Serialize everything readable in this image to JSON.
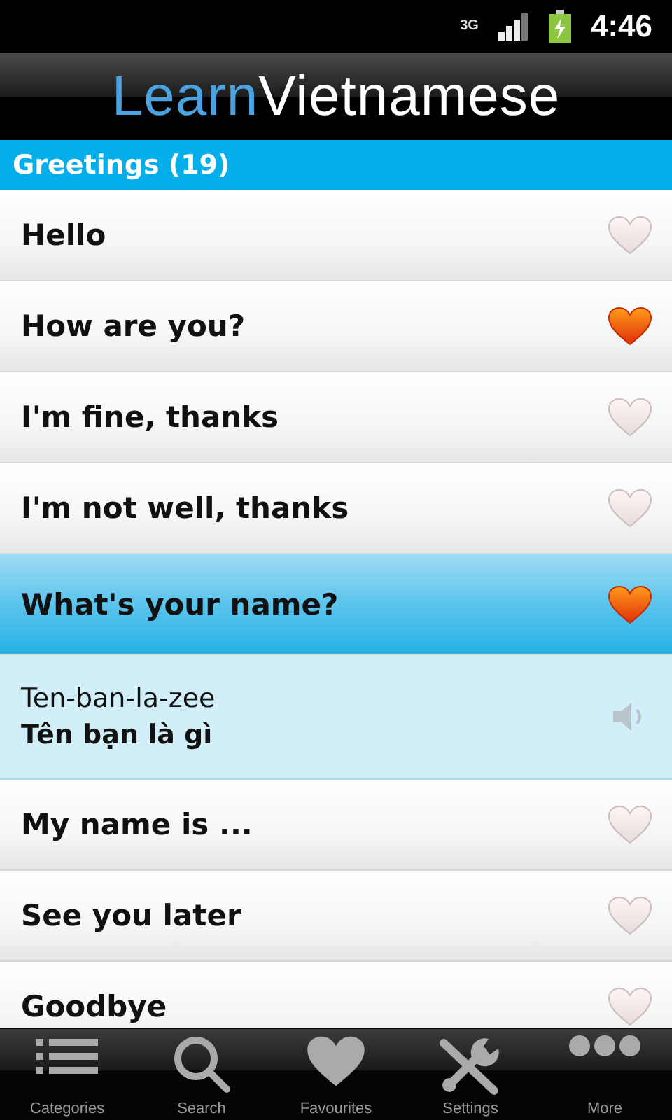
{
  "status_bar": {
    "network": "3G",
    "time": "4:46"
  },
  "logo": {
    "first": "Learn",
    "second": "Vietnamese"
  },
  "section": {
    "title": "Greetings (19)"
  },
  "rows": [
    {
      "kind": "phrase",
      "text": "Hello",
      "favourite": false,
      "selected": false
    },
    {
      "kind": "phrase",
      "text": "How are you?",
      "favourite": true,
      "selected": false
    },
    {
      "kind": "phrase",
      "text": "I'm fine, thanks",
      "favourite": false,
      "selected": false
    },
    {
      "kind": "phrase",
      "text": "I'm not well, thanks",
      "favourite": false,
      "selected": false
    },
    {
      "kind": "phrase",
      "text": "What's your name?",
      "favourite": true,
      "selected": true
    },
    {
      "kind": "detail",
      "pronunciation": "Ten-ban-la-zee",
      "translation": "Tên bạn là gì"
    },
    {
      "kind": "phrase",
      "text": "My name is ...",
      "favourite": false,
      "selected": false
    },
    {
      "kind": "phrase",
      "text": "See you later",
      "favourite": false,
      "selected": false
    },
    {
      "kind": "phrase",
      "text": "Goodbye",
      "favourite": false,
      "selected": false
    }
  ],
  "tabs": [
    {
      "kind": "categories",
      "label": "Categories"
    },
    {
      "kind": "search",
      "label": "Search"
    },
    {
      "kind": "favourites",
      "label": "Favourites"
    },
    {
      "kind": "settings",
      "label": "Settings"
    },
    {
      "kind": "more",
      "label": "More"
    }
  ]
}
